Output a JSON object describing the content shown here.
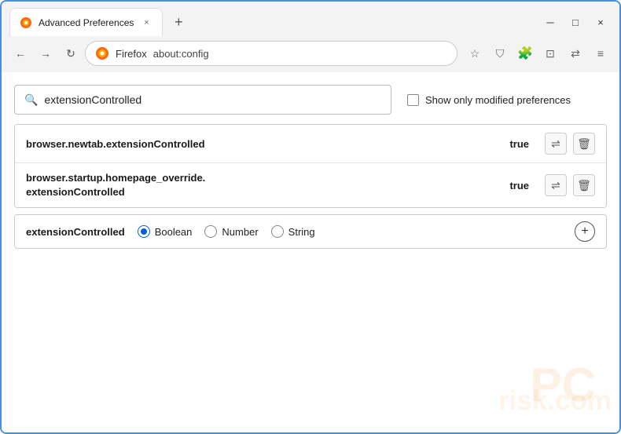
{
  "window": {
    "title": "Advanced Preferences",
    "tab_close": "×",
    "new_tab": "+",
    "minimize": "─",
    "maximize": "□",
    "close": "×"
  },
  "navbar": {
    "back": "←",
    "forward": "→",
    "reload": "↻",
    "firefox_label": "Firefox",
    "address": "about:config",
    "bookmark_icon": "☆",
    "shield_icon": "⛉",
    "extension_icon": "⊕",
    "pocket_icon": "⊡",
    "sync_icon": "⇄",
    "menu_icon": "≡"
  },
  "search": {
    "placeholder": "extensionControlled",
    "value": "extensionControlled",
    "show_modified_label": "Show only modified preferences"
  },
  "results": [
    {
      "name": "browser.newtab.extensionControlled",
      "value": "true"
    },
    {
      "name_line1": "browser.startup.homepage_override.",
      "name_line2": "extensionControlled",
      "value": "true"
    }
  ],
  "add_preference": {
    "name": "extensionControlled",
    "type_boolean": "Boolean",
    "type_number": "Number",
    "type_string": "String",
    "add_btn": "+"
  }
}
